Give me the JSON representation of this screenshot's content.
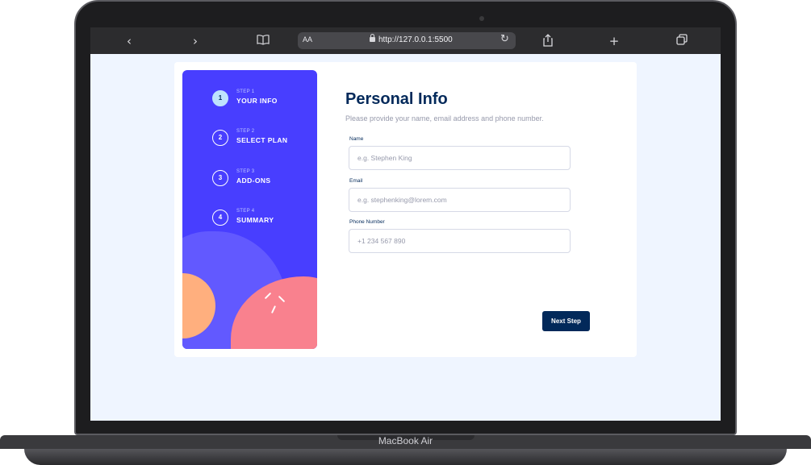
{
  "device": {
    "brand": "MacBook Air"
  },
  "browser": {
    "text_size_label": "AA",
    "url": "http://127.0.0.1:5500",
    "icons": [
      "chevron-left-icon",
      "chevron-right-icon",
      "book-icon",
      "lock-icon",
      "reload-icon",
      "share-icon",
      "plus-icon",
      "tabs-icon"
    ]
  },
  "sidebar": {
    "steps": [
      {
        "number": "1",
        "label": "STEP 1",
        "title": "YOUR INFO",
        "active": true
      },
      {
        "number": "2",
        "label": "STEP 2",
        "title": "SELECT PLAN",
        "active": false
      },
      {
        "number": "3",
        "label": "STEP 3",
        "title": "ADD-ONS",
        "active": false
      },
      {
        "number": "4",
        "label": "STEP 4",
        "title": "SUMMARY",
        "active": false
      }
    ]
  },
  "form": {
    "title": "Personal Info",
    "subtitle": "Please provide your name, email address and phone number.",
    "fields": [
      {
        "label": "Name",
        "placeholder": "e.g. Stephen King",
        "value": ""
      },
      {
        "label": "Email",
        "placeholder": "e.g. stephenking@lorem.com",
        "value": ""
      },
      {
        "label": "Phone Number",
        "placeholder": "+1 234 567 890",
        "value": ""
      }
    ],
    "next_label": "Next Step"
  },
  "colors": {
    "sidebar_bg": "#483eff",
    "primary_dark": "#02295a",
    "active_step": "#bee2fd",
    "page_bg": "#eff5ff",
    "accent_orange": "#ffaf7e",
    "accent_pink": "#f9818e"
  }
}
